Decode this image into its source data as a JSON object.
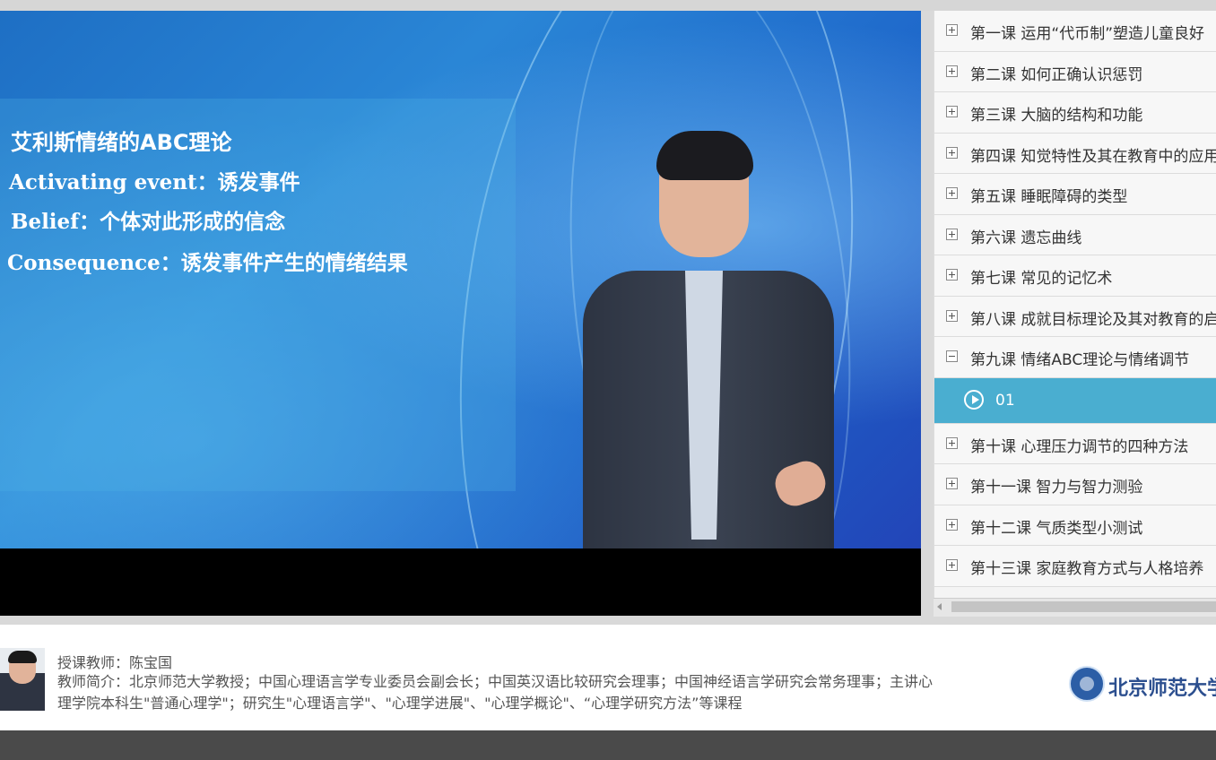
{
  "video": {
    "slide_title": "艾利斯情绪的ABC理论",
    "slide_lines": [
      "Activating event：诱发事件",
      "Belief：个体对此形成的信念",
      "Consequence：诱发事件产生的情绪结果"
    ]
  },
  "course_list": {
    "items": [
      {
        "label": "第一课 运用“代币制”塑造儿童良好",
        "expanded": false
      },
      {
        "label": "第二课 如何正确认识惩罚",
        "expanded": false
      },
      {
        "label": "第三课 大脑的结构和功能",
        "expanded": false
      },
      {
        "label": "第四课 知觉特性及其在教育中的应用",
        "expanded": false
      },
      {
        "label": "第五课 睡眠障碍的类型",
        "expanded": false
      },
      {
        "label": "第六课 遗忘曲线",
        "expanded": false
      },
      {
        "label": "第七课 常见的记忆术",
        "expanded": false
      },
      {
        "label": "第八课 成就目标理论及其对教育的启",
        "expanded": false
      },
      {
        "label": "第九课 情绪ABC理论与情绪调节",
        "expanded": true
      },
      {
        "label": "第十课 心理压力调节的四种方法",
        "expanded": false
      },
      {
        "label": "第十一课 智力与智力测验",
        "expanded": false
      },
      {
        "label": "第十二课 气质类型小测试",
        "expanded": false
      },
      {
        "label": "第十三课 家庭教育方式与人格培养",
        "expanded": false
      }
    ],
    "active_sub": "01",
    "active_color": "#4aaed0"
  },
  "teacher": {
    "name_line": "授课教师：陈宝国",
    "intro": "教师简介：北京师范大学教授；中国心理语言学专业委员会副会长；中国英汉语比较研究会理事；中国神经语言学研究会常务理事；主讲心理学院本科生\"普通心理学\"；研究生\"心理语言学\"、\"心理学进展\"、\"心理学概论\"、“心理学研究方法”等课程"
  },
  "logo": {
    "text": "北京师范大学网"
  }
}
